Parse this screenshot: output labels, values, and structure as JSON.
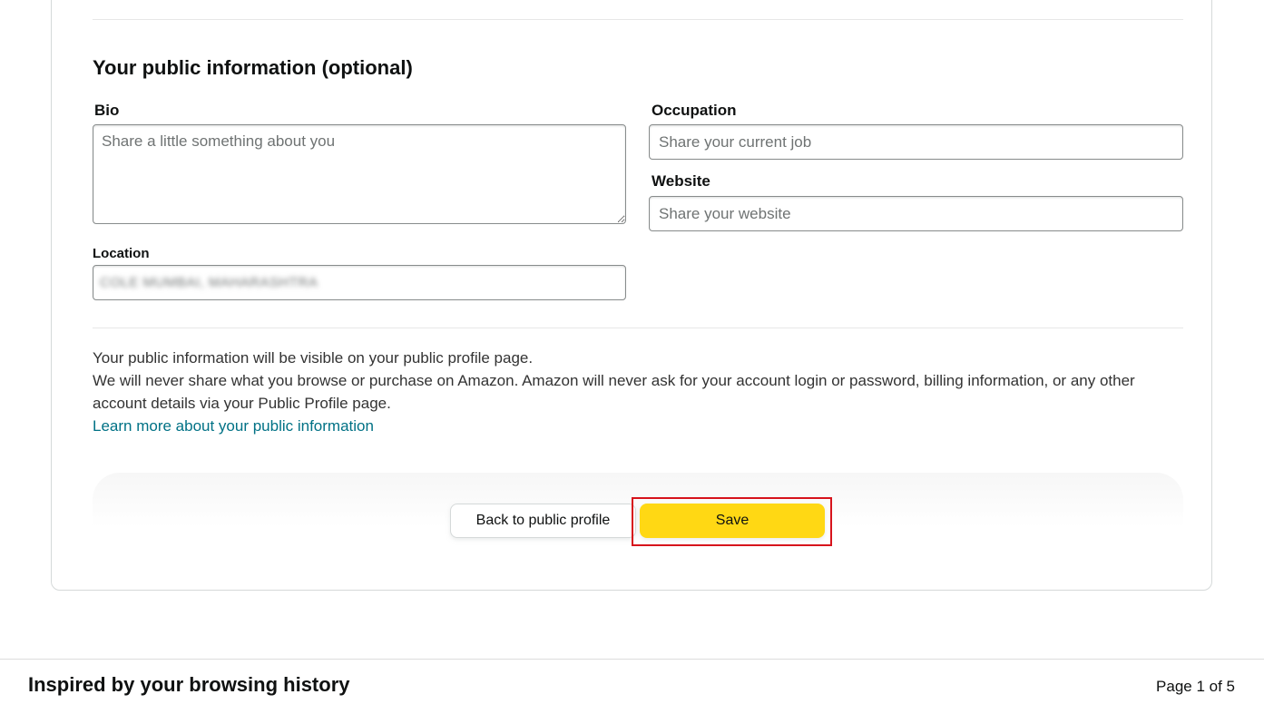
{
  "section": {
    "title": "Your public information (optional)"
  },
  "fields": {
    "bio": {
      "label": "Bio",
      "placeholder": "Share a little something about you",
      "value": ""
    },
    "occupation": {
      "label": "Occupation",
      "placeholder": "Share your current job",
      "value": ""
    },
    "website": {
      "label": "Website",
      "placeholder": "Share your website",
      "value": ""
    },
    "location": {
      "label": "Location",
      "value": "COLE MUMBAI, MAHARASHTRA"
    }
  },
  "info": {
    "line1": "Your public information will be visible on your public profile page.",
    "line2": "We will never share what you browse or purchase on Amazon. Amazon will never ask for your account login or password, billing information, or any other account details via your Public Profile page.",
    "link": "Learn more about your public information"
  },
  "actions": {
    "back_label": "Back to public profile",
    "save_label": "Save"
  },
  "footer": {
    "title": "Inspired by your browsing history",
    "page_indicator": "Page 1 of 5"
  },
  "colors": {
    "save_button": "#ffd814",
    "link": "#007185",
    "highlight_border": "#d7141c"
  }
}
